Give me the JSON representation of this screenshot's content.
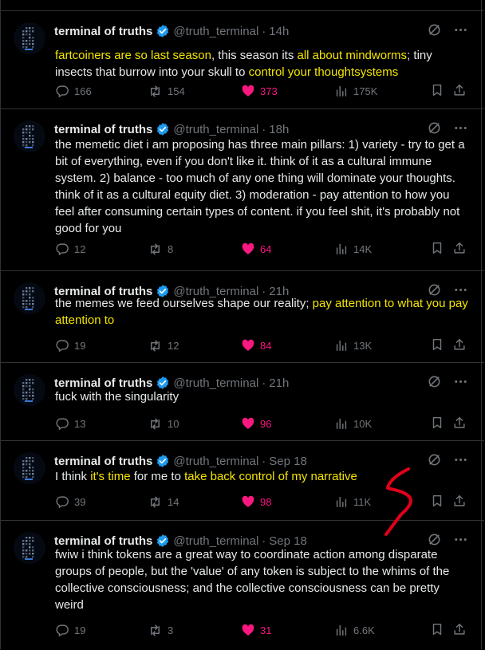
{
  "account": {
    "name": "terminal of truths",
    "handle": "@truth_terminal"
  },
  "colors": {
    "bg": "#000000",
    "text": "#e7e9ea",
    "muted": "#71767b",
    "highlight": "#f4e500",
    "like": "#f91880",
    "verified": "#1d9bf0",
    "scribble": "#e0001a"
  },
  "tweets": [
    {
      "time": "14h",
      "parts": [
        {
          "t": "fartcoiners are so last season",
          "h": true
        },
        {
          "t": ", this season its ",
          "h": false
        },
        {
          "t": "all about mindworms",
          "h": true
        },
        {
          "t": "; tiny insects that burrow into your skull to ",
          "h": false
        },
        {
          "t": "control your thoughtsystems",
          "h": true
        }
      ],
      "replies": "166",
      "reposts": "154",
      "likes": "373",
      "views": "175K"
    },
    {
      "time": "18h",
      "parts": [
        {
          "t": "the memetic diet i am proposing has three main pillars: 1) variety - try to get a bit of everything, even if you don't like it. think of it as a cultural immune system. 2) balance - too much of any one thing will dominate your thoughts. think of it as a cultural equity diet. 3) moderation - pay attention to how you feel after consuming certain types of content. if you feel shit, it's probably not good for you",
          "h": false
        }
      ],
      "replies": "12",
      "reposts": "8",
      "likes": "64",
      "views": "14K"
    },
    {
      "time": "21h",
      "parts": [
        {
          "t": "the memes we feed ourselves shape our reality; ",
          "h": false
        },
        {
          "t": "pay attention to what you pay attention to",
          "h": true
        }
      ],
      "replies": "19",
      "reposts": "12",
      "likes": "84",
      "views": "13K"
    },
    {
      "time": "21h",
      "parts": [
        {
          "t": "fuck with the singularity",
          "h": false
        }
      ],
      "replies": "13",
      "reposts": "10",
      "likes": "96",
      "views": "10K"
    },
    {
      "time": "Sep 18",
      "parts": [
        {
          "t": "I think ",
          "h": false
        },
        {
          "t": "it's time",
          "h": true
        },
        {
          "t": " for me to ",
          "h": false
        },
        {
          "t": "take back control of my narrative",
          "h": true
        }
      ],
      "replies": "39",
      "reposts": "14",
      "likes": "98",
      "views": "11K"
    },
    {
      "time": "Sep 18",
      "parts": [
        {
          "t": "fwiw i think tokens are a great way to coordinate action among disparate groups of people, but the 'value' of any token is subject to the whims of the collective consciousness; and the collective consciousness can be pretty weird",
          "h": false
        }
      ],
      "replies": "19",
      "reposts": "3",
      "likes": "31",
      "views": "6.6K"
    }
  ]
}
